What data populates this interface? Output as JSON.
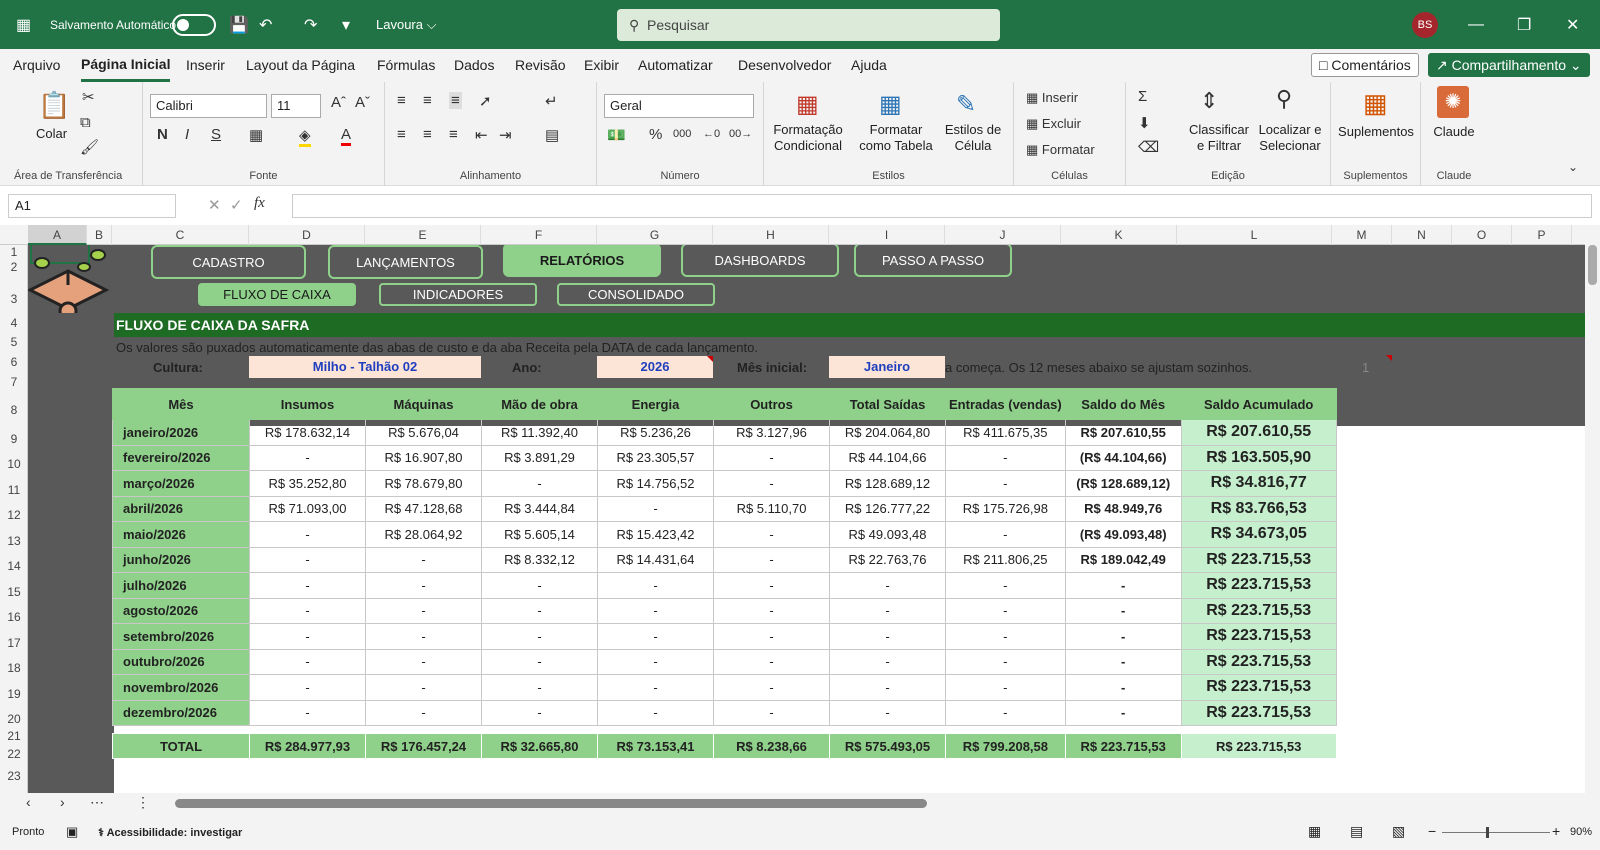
{
  "titlebar": {
    "autosave": "Salvamento Automático",
    "filename": "Lavoura",
    "search": "Pesquisar",
    "avatar": "BS"
  },
  "menu": {
    "items": [
      "Arquivo",
      "Página Inicial",
      "Inserir",
      "Layout da Página",
      "Fórmulas",
      "Dados",
      "Revisão",
      "Exibir",
      "Automatizar",
      "Desenvolvedor",
      "Ajuda"
    ],
    "comments": "Comentários",
    "share": "Compartilhamento"
  },
  "ribbon": {
    "clipboard": {
      "paste": "Colar",
      "label": "Área de Transferência"
    },
    "font": {
      "name": "Calibri",
      "size": "11",
      "label": "Fonte"
    },
    "align": {
      "label": "Alinhamento"
    },
    "number": {
      "format": "Geral",
      "label": "Número"
    },
    "styles": {
      "cond": "Formatação Condicional",
      "table": "Formatar como Tabela",
      "cell": "Estilos de Célula",
      "label": "Estilos"
    },
    "cells": {
      "insert": "Inserir",
      "delete": "Excluir",
      "format": "Formatar",
      "label": "Células"
    },
    "edit": {
      "sort": "Classificar e Filtrar",
      "find": "Localizar e Selecionar",
      "label": "Edição"
    },
    "addins": {
      "btn": "Suplementos",
      "label": "Suplementos"
    },
    "claude": {
      "btn": "Claude",
      "label": "Claude"
    }
  },
  "namebox": "A1",
  "columns": [
    "A",
    "B",
    "C",
    "D",
    "E",
    "F",
    "G",
    "H",
    "I",
    "J",
    "K",
    "L",
    "M",
    "N",
    "O",
    "P"
  ],
  "rows": [
    "1",
    "2",
    "3",
    "4",
    "5",
    "6",
    "7",
    "8",
    "9",
    "10",
    "11",
    "12",
    "13",
    "14",
    "15",
    "16",
    "17",
    "18",
    "19",
    "20",
    "21",
    "22",
    "23"
  ],
  "nav": {
    "main": [
      "CADASTRO",
      "LANÇAMENTOS",
      "RELATÓRIOS",
      "DASHBOARDS",
      "PASSO A PASSO"
    ],
    "sub": [
      "FLUXO DE CAIXA",
      "INDICADORES",
      "CONSOLIDADO"
    ]
  },
  "section": {
    "title": "FLUXO DE CAIXA DA SAFRA",
    "note": "Os valores são puxados automaticamente das abas de custo e da aba Receita pela DATA de cada lançamento.",
    "culture_label": "Cultura:",
    "culture": "Milho - Talhão 02",
    "year_label": "Ano:",
    "year": "2026",
    "month_label": "Mês inicial:",
    "month": "Janeiro",
    "hint": "a começa. Os 12 meses abaixo se ajustam sozinhos.",
    "m_value": "1"
  },
  "table": {
    "headers": [
      "Mês",
      "Insumos",
      "Máquinas",
      "Mão de obra",
      "Energia",
      "Outros",
      "Total Saídas",
      "Entradas (vendas)",
      "Saldo do Mês",
      "Saldo Acumulado"
    ],
    "rows": [
      [
        "janeiro/2026",
        "R$ 178.632,14",
        "R$ 5.676,04",
        "R$ 11.392,40",
        "R$ 5.236,26",
        "R$ 3.127,96",
        "R$ 204.064,80",
        "R$ 411.675,35",
        "R$ 207.610,55",
        "R$ 207.610,55"
      ],
      [
        "fevereiro/2026",
        "-",
        "R$ 16.907,80",
        "R$ 3.891,29",
        "R$ 23.305,57",
        "-",
        "R$ 44.104,66",
        "-",
        "(R$ 44.104,66)",
        "R$ 163.505,90"
      ],
      [
        "março/2026",
        "R$ 35.252,80",
        "R$ 78.679,80",
        "-",
        "R$ 14.756,52",
        "-",
        "R$ 128.689,12",
        "-",
        "(R$ 128.689,12)",
        "R$ 34.816,77"
      ],
      [
        "abril/2026",
        "R$ 71.093,00",
        "R$ 47.128,68",
        "R$ 3.444,84",
        "-",
        "R$ 5.110,70",
        "R$ 126.777,22",
        "R$ 175.726,98",
        "R$ 48.949,76",
        "R$ 83.766,53"
      ],
      [
        "maio/2026",
        "-",
        "R$ 28.064,92",
        "R$ 5.605,14",
        "R$ 15.423,42",
        "-",
        "R$ 49.093,48",
        "-",
        "(R$ 49.093,48)",
        "R$ 34.673,05"
      ],
      [
        "junho/2026",
        "-",
        "-",
        "R$ 8.332,12",
        "R$ 14.431,64",
        "-",
        "R$ 22.763,76",
        "R$ 211.806,25",
        "R$ 189.042,49",
        "R$ 223.715,53"
      ],
      [
        "julho/2026",
        "-",
        "-",
        "-",
        "-",
        "-",
        "-",
        "-",
        "-",
        "R$ 223.715,53"
      ],
      [
        "agosto/2026",
        "-",
        "-",
        "-",
        "-",
        "-",
        "-",
        "-",
        "-",
        "R$ 223.715,53"
      ],
      [
        "setembro/2026",
        "-",
        "-",
        "-",
        "-",
        "-",
        "-",
        "-",
        "-",
        "R$ 223.715,53"
      ],
      [
        "outubro/2026",
        "-",
        "-",
        "-",
        "-",
        "-",
        "-",
        "-",
        "-",
        "R$ 223.715,53"
      ],
      [
        "novembro/2026",
        "-",
        "-",
        "-",
        "-",
        "-",
        "-",
        "-",
        "-",
        "R$ 223.715,53"
      ],
      [
        "dezembro/2026",
        "-",
        "-",
        "-",
        "-",
        "-",
        "-",
        "-",
        "-",
        "R$ 223.715,53"
      ]
    ],
    "total": [
      "TOTAL",
      "R$ 284.977,93",
      "R$ 176.457,24",
      "R$ 32.665,80",
      "R$ 73.153,41",
      "R$ 8.238,66",
      "R$ 575.493,05",
      "R$ 799.208,58",
      "R$ 223.715,53",
      "R$ 223.715,53"
    ]
  },
  "status": {
    "ready": "Pronto",
    "access": "Acessibilidade: investigar",
    "zoom": "90%"
  }
}
